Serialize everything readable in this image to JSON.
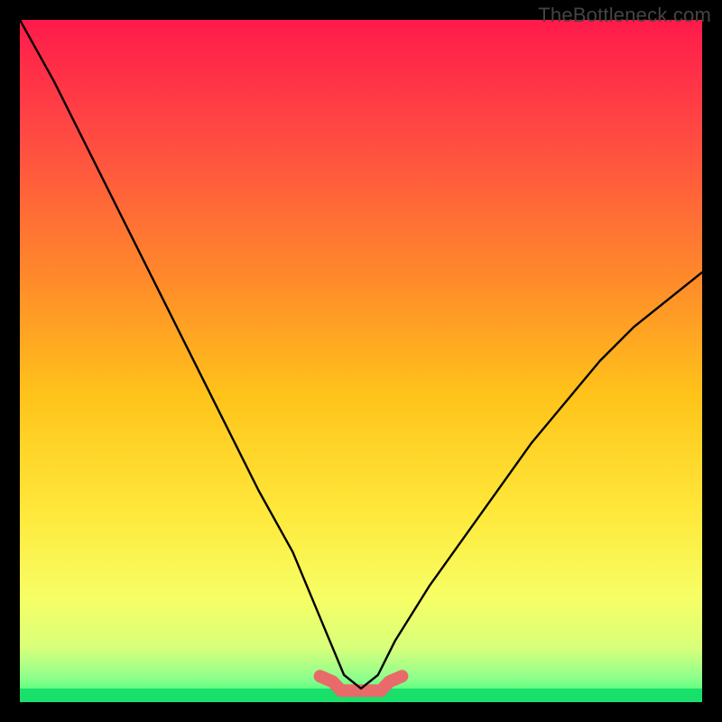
{
  "watermark": "TheBottleneck.com",
  "chart_data": {
    "type": "line",
    "title": "",
    "xlabel": "",
    "ylabel": "",
    "xlim": [
      0,
      1
    ],
    "ylim": [
      0,
      1
    ],
    "note": "Unlabeled axes; values are normalized 0–1 estimates read off the figure. 'value' approximates the black curve height; 'green_band' is the thin green strip at the bottom; 'red_highlight' is the short coral segment near the minimum.",
    "x": [
      0.0,
      0.05,
      0.1,
      0.15,
      0.2,
      0.25,
      0.3,
      0.35,
      0.4,
      0.45,
      0.475,
      0.5,
      0.525,
      0.55,
      0.6,
      0.65,
      0.7,
      0.75,
      0.8,
      0.85,
      0.9,
      0.95,
      1.0
    ],
    "series": [
      {
        "name": "curve",
        "values": [
          1.0,
          0.91,
          0.81,
          0.71,
          0.61,
          0.51,
          0.41,
          0.31,
          0.22,
          0.1,
          0.04,
          0.02,
          0.04,
          0.09,
          0.17,
          0.24,
          0.31,
          0.38,
          0.44,
          0.5,
          0.55,
          0.59,
          0.63
        ]
      }
    ],
    "green_band": {
      "y0": 0.0,
      "y1": 0.02
    },
    "red_highlight": {
      "x0": 0.44,
      "x1": 0.56,
      "y": 0.03
    },
    "gradient_stops": [
      {
        "pos": 0.0,
        "color": "#ff1a4b"
      },
      {
        "pos": 0.18,
        "color": "#ff4d42"
      },
      {
        "pos": 0.38,
        "color": "#ff8a2a"
      },
      {
        "pos": 0.55,
        "color": "#ffc31a"
      },
      {
        "pos": 0.72,
        "color": "#ffe83a"
      },
      {
        "pos": 0.85,
        "color": "#f6ff66"
      },
      {
        "pos": 0.92,
        "color": "#d8ff7a"
      },
      {
        "pos": 0.965,
        "color": "#8dff8d"
      },
      {
        "pos": 1.0,
        "color": "#2bff77"
      }
    ]
  }
}
